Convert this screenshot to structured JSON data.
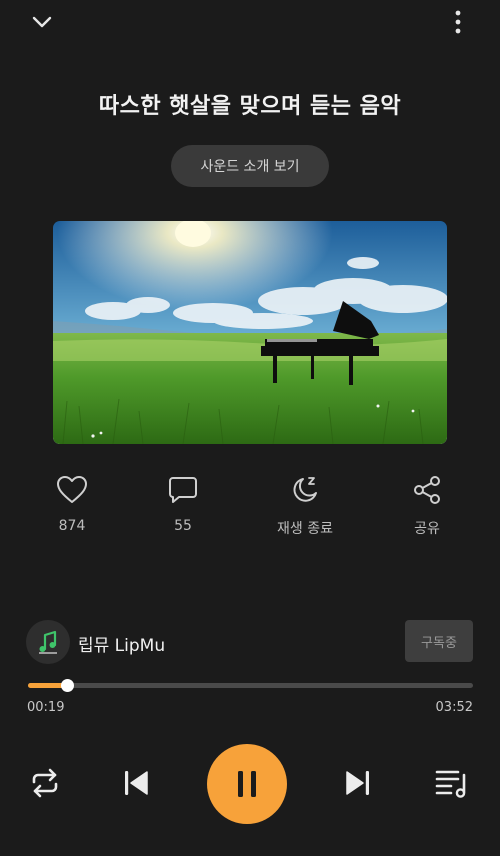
{
  "header": {
    "collapse_icon": "chevron-down-icon",
    "more_icon": "more-vertical-icon"
  },
  "title": "따스한 햇살을 맞으며 듣는 음악",
  "intro_button": "사운드 소개 보기",
  "cover": {
    "image": "piano-in-sunny-meadow"
  },
  "actions": [
    {
      "icon": "heart-icon",
      "label": "874"
    },
    {
      "icon": "comment-icon",
      "label": "55"
    },
    {
      "icon": "sleep-timer-icon",
      "label": "재생 종료"
    },
    {
      "icon": "share-icon",
      "label": "공유"
    }
  ],
  "channel": {
    "name": "립뮤 LipMu",
    "subscribe_label": "구독중"
  },
  "player": {
    "current_time": "00:19",
    "duration": "03:52",
    "progress": 0.088,
    "accent_color": "#f7a23a",
    "controls": [
      "repeat-icon",
      "previous-icon",
      "pause-icon",
      "next-icon",
      "playlist-icon"
    ]
  }
}
